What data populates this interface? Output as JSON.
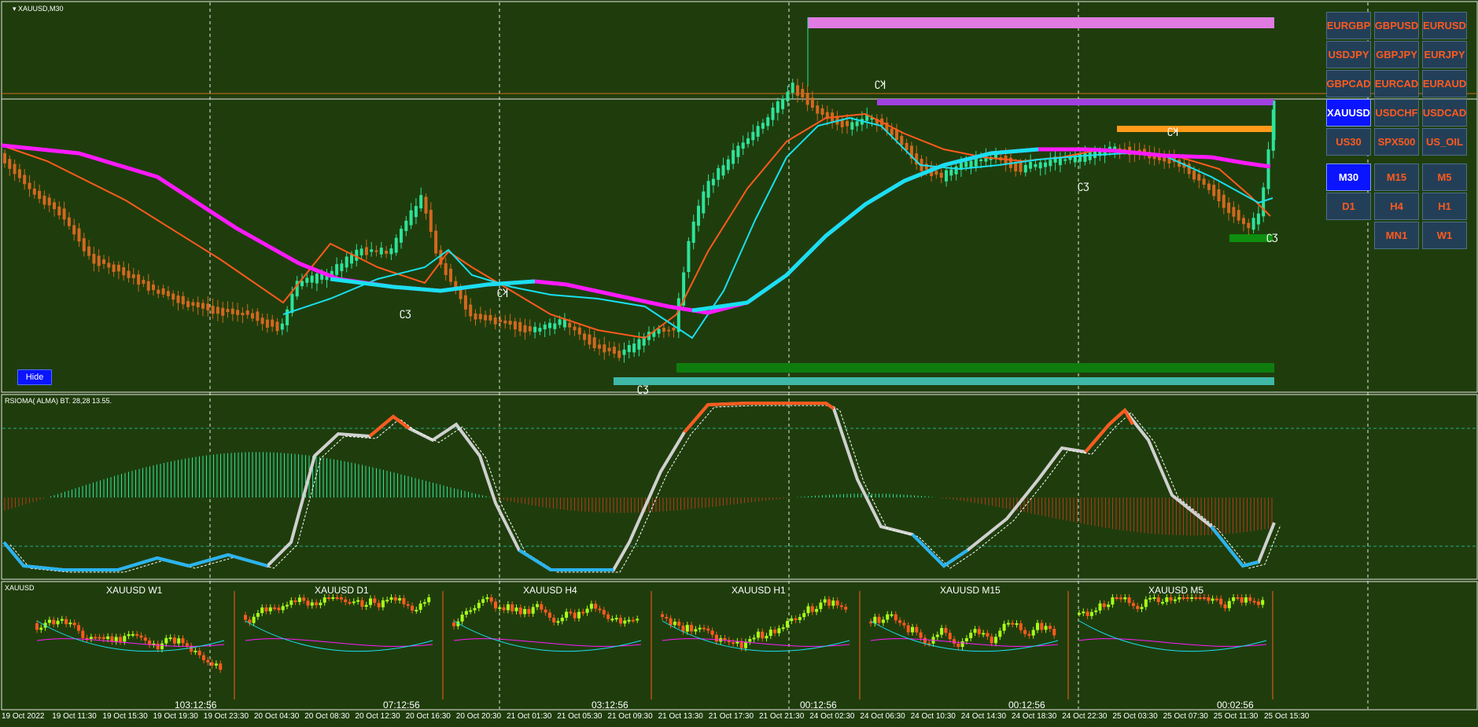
{
  "chart": {
    "title": "XAUUSD,M30",
    "hide_label": "Hide",
    "indicator_title": "RSIOMA( ALMA) BT. 28,28 13.55.",
    "sub_title": "XAUUSD"
  },
  "symbols": [
    {
      "label": "EURGBP",
      "active": false
    },
    {
      "label": "GBPUSD",
      "active": false
    },
    {
      "label": "EURUSD",
      "active": false
    },
    {
      "label": "USDJPY",
      "active": false
    },
    {
      "label": "GBPJPY",
      "active": false
    },
    {
      "label": "EURJPY",
      "active": false
    },
    {
      "label": "GBPCAD",
      "active": false
    },
    {
      "label": "EURCAD",
      "active": false
    },
    {
      "label": "EURAUD",
      "active": false
    },
    {
      "label": "XAUUSD",
      "active": true
    },
    {
      "label": "USDCHF",
      "active": false
    },
    {
      "label": "USDCAD",
      "active": false
    },
    {
      "label": "US30",
      "active": false
    },
    {
      "label": "SPX500",
      "active": false
    },
    {
      "label": "US_OIL",
      "active": false
    }
  ],
  "timeframes": [
    {
      "label": "M30",
      "active": true
    },
    {
      "label": "M15",
      "active": false
    },
    {
      "label": "M5",
      "active": false
    },
    {
      "label": "D1",
      "active": false
    },
    {
      "label": "H4",
      "active": false
    },
    {
      "label": "H1",
      "active": false
    },
    {
      "label": "MN1",
      "active": false
    },
    {
      "label": "W1",
      "active": false
    }
  ],
  "mini_charts": [
    {
      "label": "XAUUSD W1",
      "timer": "103:12:56"
    },
    {
      "label": "XAUUSD D1",
      "timer": "07:12:56"
    },
    {
      "label": "XAUUSD H4",
      "timer": "03:12:56"
    },
    {
      "label": "XAUUSD H1",
      "timer": "00:12:56"
    },
    {
      "label": "XAUUSD M15",
      "timer": "00:12:56"
    },
    {
      "label": "XAUUSD M5",
      "timer": "00:02:56"
    }
  ],
  "x_axis": [
    "19 Oct 2022",
    "19 Oct 11:30",
    "19 Oct 15:30",
    "19 Oct 19:30",
    "19 Oct 23:30",
    "20 Oct 04:30",
    "20 Oct 08:30",
    "20 Oct 12:30",
    "20 Oct 16:30",
    "20 Oct 20:30",
    "21 Oct 01:30",
    "21 Oct 05:30",
    "21 Oct 09:30",
    "21 Oct 13:30",
    "21 Oct 17:30",
    "21 Oct 21:30",
    "24 Oct 02:30",
    "24 Oct 06:30",
    "24 Oct 10:30",
    "24 Oct 14:30",
    "24 Oct 18:30",
    "24 Oct 22:30",
    "25 Oct 03:30",
    "25 Oct 07:30",
    "25 Oct 11:30",
    "25 Oct 15:30"
  ],
  "colors": {
    "background": "#1f3d0c",
    "bull": "#2de39b",
    "bear": "#d2691e",
    "ma_fast": "#ff5a1e",
    "ma_cyan": "#19e0f0",
    "ma_magenta": "#ff1aff"
  }
}
